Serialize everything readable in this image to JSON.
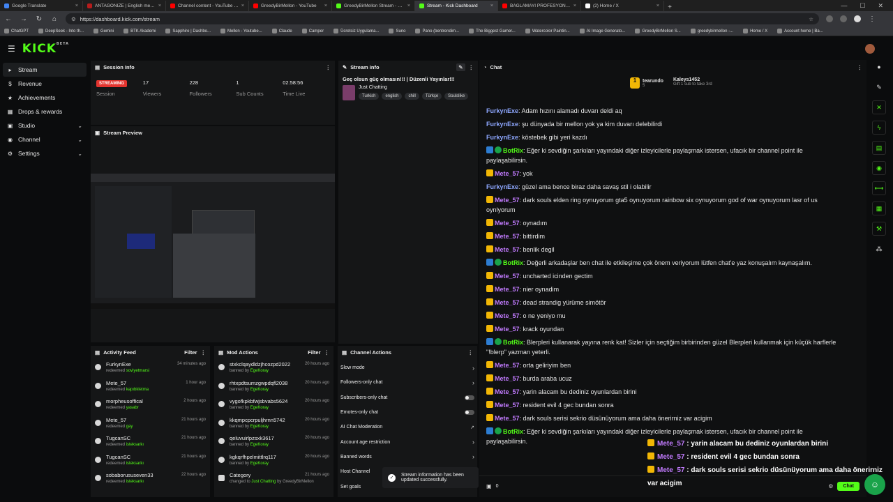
{
  "browser": {
    "tabs": [
      {
        "title": "Google Translate",
        "color": "#4285f4"
      },
      {
        "title": "ANTAGONIZE | English meaning -",
        "color": "#b71c1c"
      },
      {
        "title": "Channel content - YouTube Studio",
        "color": "#ff0000"
      },
      {
        "title": "GreedyBirMellon - YouTube",
        "color": "#ff0000"
      },
      {
        "title": "GreedyBirMellon Stream - Watch",
        "color": "#53fc18"
      },
      {
        "title": "Stream - Kick Dashboard",
        "color": "#53fc18"
      },
      {
        "title": "BAĞLAMAYI PROFESYONEL ÇALMA",
        "color": "#ff0000"
      },
      {
        "title": "(2) Home / X",
        "color": "#ffffff"
      }
    ],
    "url": "https://dashboard.kick.com/stream",
    "bookmarks": [
      "ChatGPT",
      "DeepSeek - Into th...",
      "Gemini",
      "BTK Akademi",
      "Sapphire | Dashbo...",
      "Mellon - Youtube...",
      "Claude",
      "Camper",
      "Ücretsiz Uygulama...",
      "Suno",
      "Pano (bentrendim...",
      "The Biggest Gamer...",
      "Watercolor Paintin...",
      "AI Image Generato...",
      "GreedyBirMellon S...",
      "greedybirmellon -...",
      "Home / X",
      "Account home | Ba..."
    ]
  },
  "header": {
    "logo": "KICK",
    "logo_sup": "BETA"
  },
  "nav": {
    "items": [
      {
        "label": "Stream",
        "icon": "▸",
        "chev": ""
      },
      {
        "label": "Revenue",
        "icon": "$",
        "chev": ""
      },
      {
        "label": "Achievements",
        "icon": "★",
        "chev": ""
      },
      {
        "label": "Drops & rewards",
        "icon": "▦",
        "chev": ""
      },
      {
        "label": "Studio",
        "icon": "▣",
        "chev": "⌄"
      },
      {
        "label": "Channel",
        "icon": "◉",
        "chev": "⌄"
      },
      {
        "label": "Settings",
        "icon": "⚙",
        "chev": "⌄"
      }
    ]
  },
  "session": {
    "title": "Session Info",
    "status": "STREAMING",
    "status_label": "Session",
    "viewers": "17",
    "viewers_label": "Viewers",
    "followers": "228",
    "followers_label": "Followers",
    "subs": "1",
    "subs_label": "Sub Counts",
    "time": "02:58:56",
    "time_label": "Time Live"
  },
  "stream_info": {
    "title": "Stream info",
    "stream_title": "Geç olsun güç olmasın!!! | Düzenli Yayınlar!!!",
    "category": "Just Chatting",
    "tags": [
      "Turkish",
      "english",
      "chill",
      "Türkçe",
      "Soulslike"
    ]
  },
  "preview": {
    "title": "Stream Preview"
  },
  "activity": {
    "title": "Activity Feed",
    "filter": "Filter",
    "items": [
      {
        "user": "FurkynExe",
        "time": "34 minutes ago",
        "action": "redeemed",
        "reward": "soviyetmarsi"
      },
      {
        "user": "Mete_57",
        "time": "1 hour ago",
        "action": "redeemed",
        "reward": "kapıbkletma"
      },
      {
        "user": "morpheusoffical",
        "time": "2 hours ago",
        "action": "redeemed",
        "reward": "yasabr"
      },
      {
        "user": "Mete_57",
        "time": "21 hours ago",
        "action": "redeemed",
        "reward": "gay"
      },
      {
        "user": "TugcanSC",
        "time": "21 hours ago",
        "action": "redeemed",
        "reward": "isteksarkı"
      },
      {
        "user": "TugcanSC",
        "time": "21 hours ago",
        "action": "redeemed",
        "reward": "isteksarkı"
      },
      {
        "user": "sobaborususeven33",
        "time": "22 hours ago",
        "action": "redeemed",
        "reward": "isteksarkı"
      }
    ]
  },
  "mod": {
    "title": "Mod Actions",
    "filter": "Filter",
    "items": [
      {
        "user": "stxkclqaydldzjhcozpd2022",
        "time": "20 hours ago",
        "action": "banned by",
        "by": "EgeKoray",
        "extra": ""
      },
      {
        "user": "rhtxpdtsumzgwpdqfl2038",
        "time": "20 hours ago",
        "action": "banned by",
        "by": "EgeKoray",
        "extra": ""
      },
      {
        "user": "vygofkpkbfwjsbvabs5624",
        "time": "20 hours ago",
        "action": "banned by",
        "by": "EgeKoray",
        "extra": ""
      },
      {
        "user": "kkqmpcpcrpuljhrnn5742",
        "time": "20 hours ago",
        "action": "banned by",
        "by": "EgeKoray",
        "extra": ""
      },
      {
        "user": "qeluvuirlpzsxk3617",
        "time": "20 hours ago",
        "action": "banned by",
        "by": "EgeKoray",
        "extra": ""
      },
      {
        "user": "kgkqrfhpelmittlrq117",
        "time": "20 hours ago",
        "action": "banned by",
        "by": "EgeKoray",
        "extra": ""
      },
      {
        "user": "Category",
        "time": "21 hours ago",
        "action": "changed to",
        "by": "Just Chatting",
        "extra": "by GreedyBirMellon"
      }
    ]
  },
  "channel_actions": {
    "title": "Channel Actions",
    "items": [
      {
        "label": "Slow mode",
        "kind": "chev"
      },
      {
        "label": "Followers-only chat",
        "kind": "chev"
      },
      {
        "label": "Subscribers-only chat",
        "kind": "toggle"
      },
      {
        "label": "Emotes-only chat",
        "kind": "toggle"
      },
      {
        "label": "AI Chat Moderation",
        "kind": "ext"
      },
      {
        "label": "Account age restriction",
        "kind": "chev"
      },
      {
        "label": "Banned words",
        "kind": "chev"
      },
      {
        "label": "Host Channel",
        "kind": "none"
      },
      {
        "label": "Set goals",
        "kind": "none"
      }
    ]
  },
  "toast": {
    "text": "Stream information has been updated successfully."
  },
  "chat": {
    "title": "Chat",
    "gifter": "tearundo",
    "gifter_count": "5",
    "top": "Kaleys1452",
    "top_note": "Gift 1 sub to take 3rd",
    "messages": [
      {
        "user": "FurkynExe",
        "kind": "f",
        "text": "Adam hızını alamadı duvarı deldi aq"
      },
      {
        "user": "FurkynExe",
        "kind": "f",
        "text": "şu dünyada bir mellon yok ya kim duvarı delebilirdi"
      },
      {
        "user": "FurkynExe",
        "kind": "f",
        "text": "köstebek gibi yeri kazdı"
      },
      {
        "user": "BotRix",
        "kind": "b",
        "text": "Eğer ki sevdiğin şarkıları yayındaki diğer izleyicilerle paylaşmak istersen, ufacık bir channel point ile paylaşabilirsin."
      },
      {
        "user": "Mete_57",
        "kind": "m",
        "text": "yok"
      },
      {
        "user": "FurkynExe",
        "kind": "f",
        "text": "güzel ama bence biraz daha savaş stil i olabilir"
      },
      {
        "user": "Mete_57",
        "kind": "m",
        "text": "dark souls elden ring oynuyorum gta5 oynuyorum rainbow six oynuyorum god of war oynuyorum lasr of us oynlyorum"
      },
      {
        "user": "Mete_57",
        "kind": "m",
        "text": "oynadım"
      },
      {
        "user": "Mete_57",
        "kind": "m",
        "text": "bittirdim"
      },
      {
        "user": "Mete_57",
        "kind": "m",
        "text": "benlik degil"
      },
      {
        "user": "BotRix",
        "kind": "b",
        "text": "Değerli arkadaşlar ben chat ile etkileşime çok önem veriyorum lütfen chat'e yaz konuşalım kaynaşalım."
      },
      {
        "user": "Mete_57",
        "kind": "m",
        "text": "uncharted icinden gectim"
      },
      {
        "user": "Mete_57",
        "kind": "m",
        "text": "nier oynadim"
      },
      {
        "user": "Mete_57",
        "kind": "m",
        "text": "dead strandig yürüme simötör"
      },
      {
        "user": "Mete_57",
        "kind": "m",
        "text": "o ne yeniyo mu"
      },
      {
        "user": "Mete_57",
        "kind": "m",
        "text": "krack oyundan"
      },
      {
        "user": "BotRix",
        "kind": "b",
        "text": "Blerpleri kullanarak yayına renk kat! Sizler için seçtiğim birbirinden güzel Blerpleri kullanmak için küçük harflerle \"!blerp\" yazman yeterli."
      },
      {
        "user": "Mete_57",
        "kind": "m",
        "text": "orta geliriyim ben"
      },
      {
        "user": "Mete_57",
        "kind": "m",
        "text": "burda araba ucuz"
      },
      {
        "user": "Mete_57",
        "kind": "m",
        "text": "yarin alacam bu dediniz oyunlardan birini"
      },
      {
        "user": "Mete_57",
        "kind": "m",
        "text": "resident evil 4 gec bundan sonra"
      },
      {
        "user": "Mete_57",
        "kind": "m",
        "text": "dark souls serisi sekrio düsünüyorum ama daha önerirniz var acigim"
      },
      {
        "user": "BotRix",
        "kind": "b",
        "text": "Eğer ki sevdiğin şarkıları yayındaki diğer izleyicilerle paylaşmak istersen, ufacık bir channel point ile paylaşabilirsin."
      }
    ],
    "count": "0",
    "send": "Chat"
  },
  "overlay": {
    "lines": [
      {
        "user": "Mete_57",
        "text": " : yarin alacam bu dediniz oyunlardan birini"
      },
      {
        "user": "Mete_57",
        "text": " : resident evil 4 gec bundan sonra"
      },
      {
        "user": "Mete_57",
        "text": " : dark souls serisi sekrio düsünüyorum ama daha önerirniz var acigim"
      }
    ]
  },
  "colors": {
    "accent": "#53fc18",
    "streaming": "#e3342f",
    "mod_user": "#c27bff",
    "follower_user": "#8ea7ff"
  }
}
